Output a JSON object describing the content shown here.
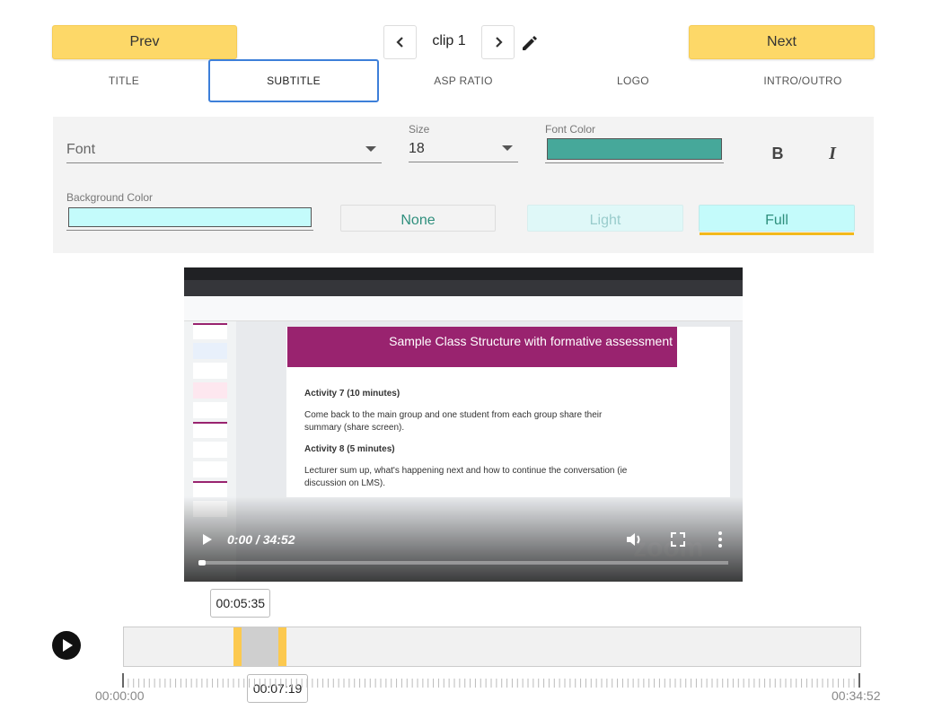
{
  "nav": {
    "prev_label": "Prev",
    "next_label": "Next",
    "clip_label": "clip 1"
  },
  "tabs": [
    {
      "label": "TITLE",
      "active": false
    },
    {
      "label": "SUBTITLE",
      "active": true
    },
    {
      "label": "ASP RATIO",
      "active": false
    },
    {
      "label": "LOGO",
      "active": false
    },
    {
      "label": "INTRO/OUTRO",
      "active": false
    }
  ],
  "subtitle_settings": {
    "font_placeholder": "Font",
    "size_label": "Size",
    "size_value": "18",
    "font_color_label": "Font Color",
    "font_color": "#46a89a",
    "background_color_label": "Background Color",
    "background_color": "#c4fbfb",
    "bold_label": "B",
    "italic_label": "I",
    "style_options": [
      {
        "label": "None",
        "selected": false
      },
      {
        "label": "Light",
        "selected": false
      },
      {
        "label": "Full",
        "selected": true
      }
    ]
  },
  "video": {
    "time_display": "0:00 / 34:52",
    "progress_fraction": 0.0,
    "slide_title": "Sample Class Structure with formative assessment",
    "slide_lines": [
      {
        "text": "Activity 7 (10 minutes)",
        "bold": true
      },
      {
        "text": "Come back to the main group and one student from each group share their",
        "bold": false
      },
      {
        "text": "summary (share screen).",
        "bold": false
      },
      {
        "text": "Activity 8 (5 minutes)",
        "bold": true
      },
      {
        "text": "Lecturer sum up, what's happening next and how to continue the conversation (ie",
        "bold": false
      },
      {
        "text": "discussion on LMS).",
        "bold": false
      }
    ],
    "watermark": "zoom"
  },
  "timeline": {
    "start_marker": "00:05:35",
    "end_marker": "00:07:19",
    "start_time": "00:00:00",
    "end_time": "00:34:52",
    "total_seconds": 2092,
    "selection_start_seconds": 335,
    "selection_end_seconds": 439
  },
  "colors": {
    "accent_yellow": "#fdd868",
    "tab_border": "#3d7fd9",
    "handle_yellow": "#fcc94f",
    "slide_banner": "#99236f",
    "full_underline": "#f3b81b"
  }
}
